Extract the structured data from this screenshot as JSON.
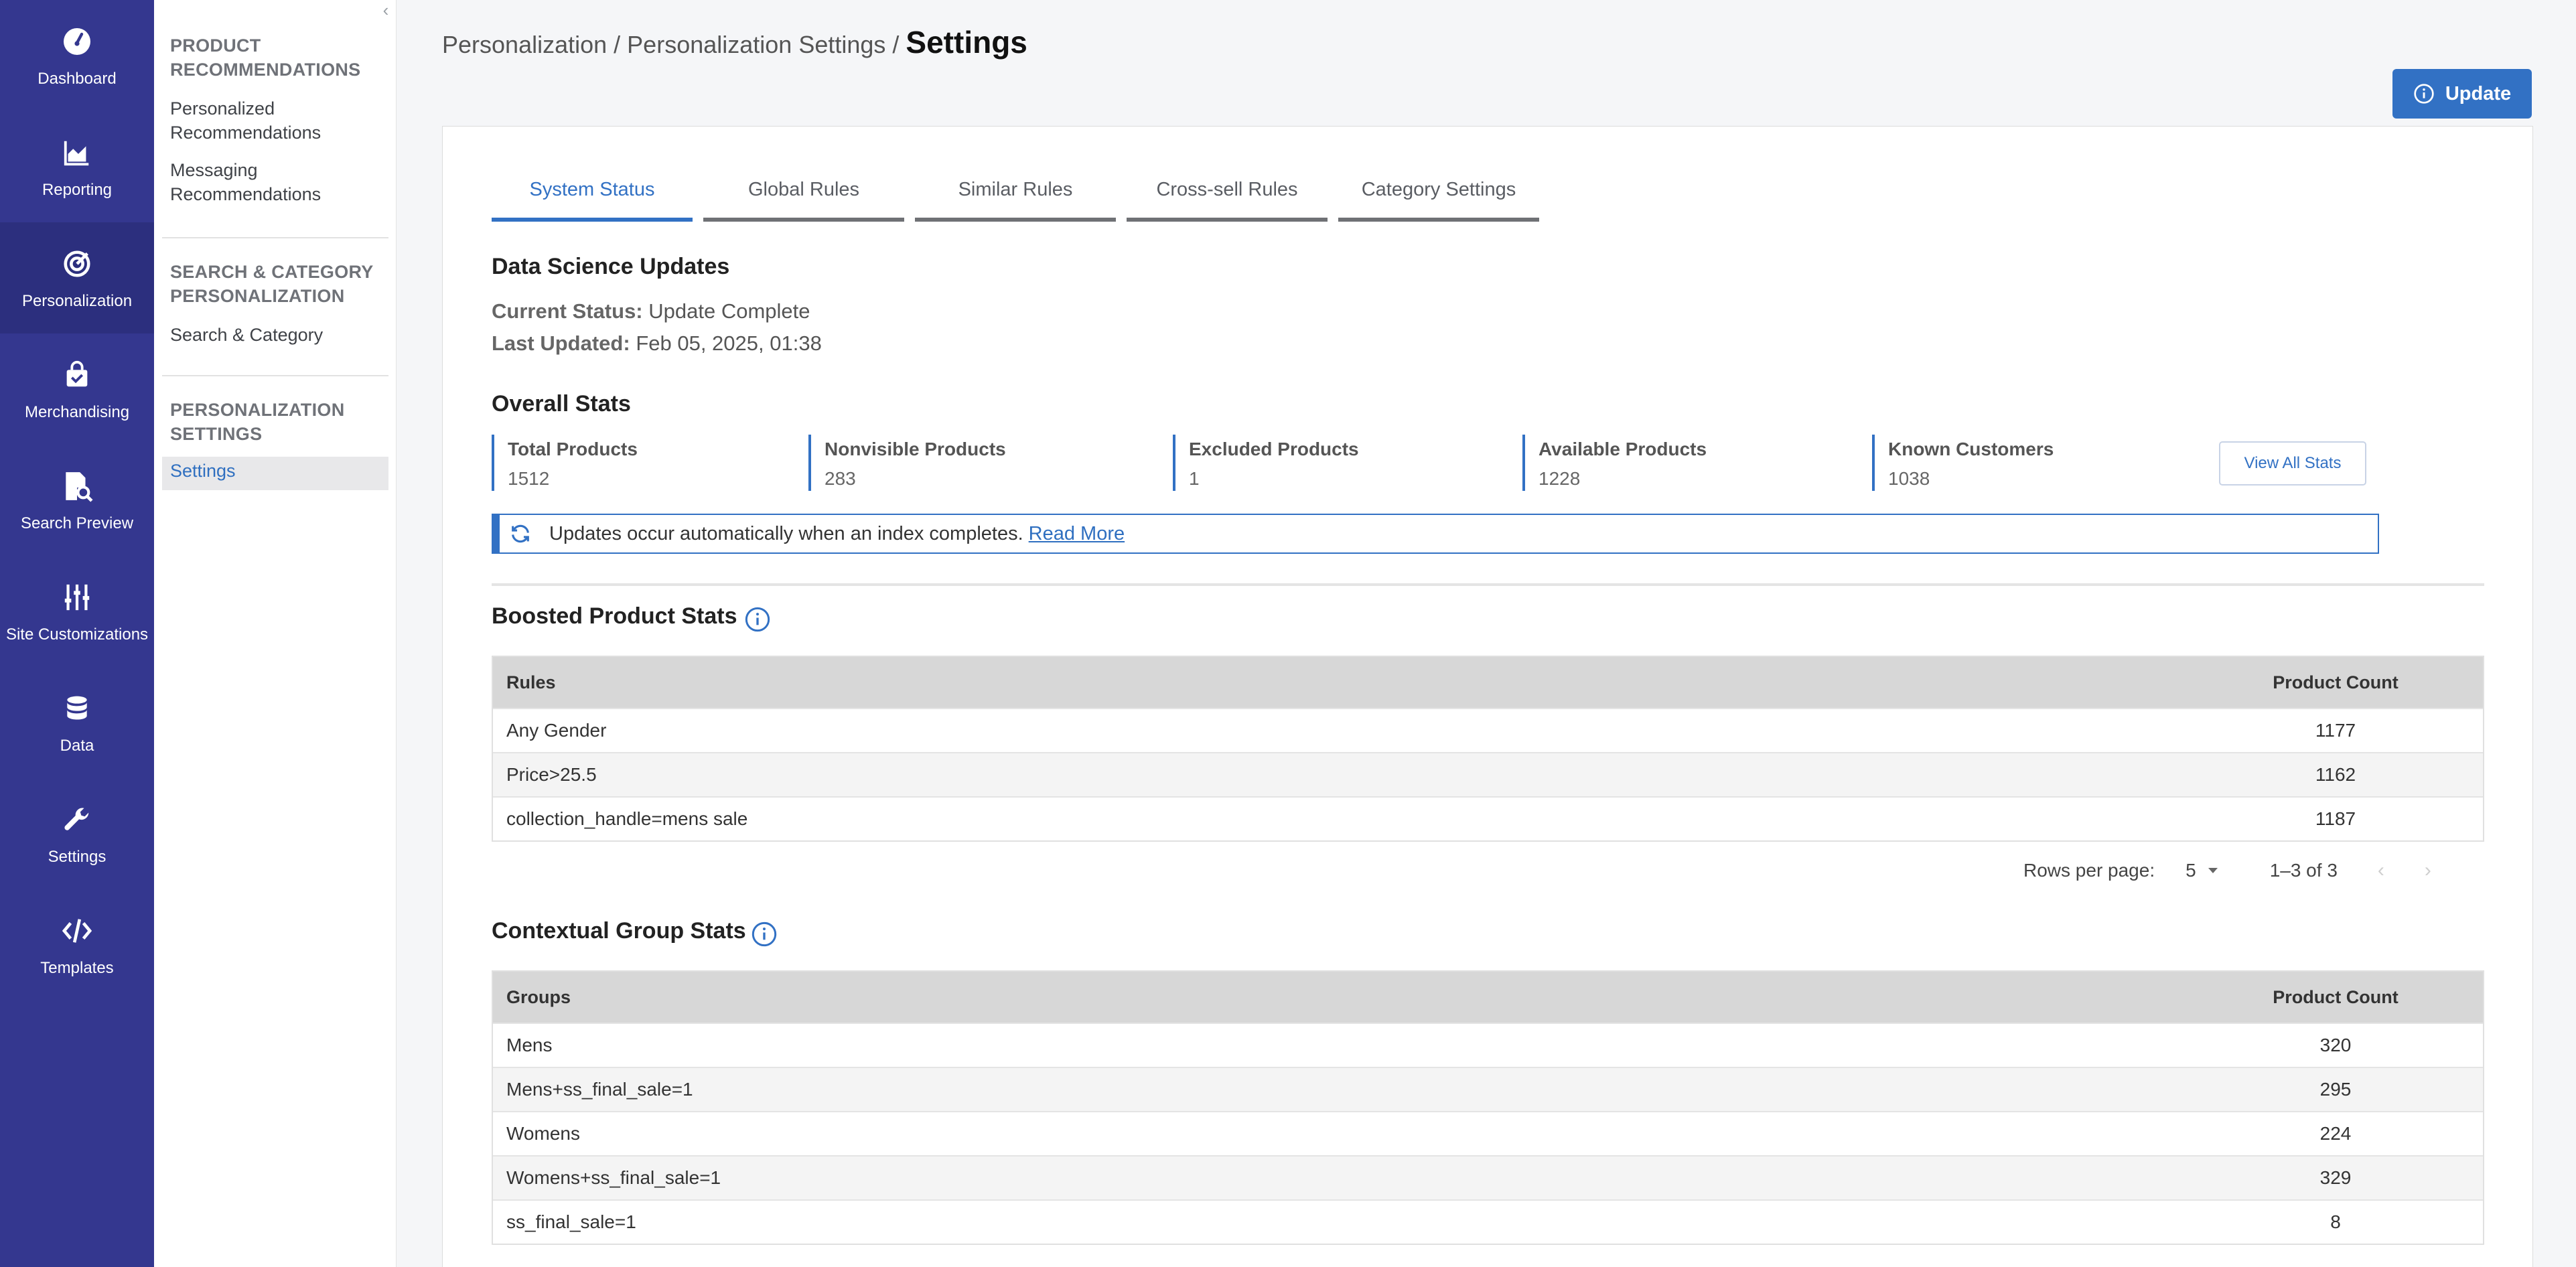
{
  "rail": {
    "items": [
      {
        "label": "Dashboard",
        "icon": "dashboard-gauge-icon"
      },
      {
        "label": "Reporting",
        "icon": "area-chart-icon"
      },
      {
        "label": "Personalization",
        "icon": "target-icon"
      },
      {
        "label": "Merchandising",
        "icon": "shopping-bag-icon"
      },
      {
        "label": "Search Preview",
        "icon": "search-document-icon"
      },
      {
        "label": "Site Customizations",
        "icon": "sliders-icon"
      },
      {
        "label": "Data",
        "icon": "database-icon"
      },
      {
        "label": "Settings",
        "icon": "wrench-icon"
      },
      {
        "label": "Templates",
        "icon": "code-icon"
      }
    ],
    "active": "Personalization"
  },
  "subnav": {
    "sections": [
      {
        "title_line1": "PRODUCT",
        "title_line2": "RECOMMENDATIONS",
        "links": [
          {
            "line1": "Personalized",
            "line2": "Recommendations"
          },
          {
            "line1": "Messaging",
            "line2": "Recommendations"
          }
        ]
      },
      {
        "title_line1": "SEARCH & CATEGORY",
        "title_line2": "PERSONALIZATION",
        "links": [
          {
            "line1": "Search & Category"
          }
        ]
      },
      {
        "title_line1": "PERSONALIZATION",
        "title_line2": "SETTINGS",
        "links": [
          {
            "line1": "Settings"
          }
        ]
      }
    ],
    "collapse_glyph": "‹"
  },
  "header": {
    "crumb1": "Personalization",
    "sep": " / ",
    "crumb2": "Personalization Settings",
    "current": "Settings",
    "update_label": "Update"
  },
  "tabs": [
    "System Status",
    "Global Rules",
    "Similar Rules",
    "Cross-sell Rules",
    "Category Settings"
  ],
  "active_tab": "System Status",
  "data_science": {
    "title": "Data Science Updates",
    "status_label": "Current Status:",
    "status_value": "Update Complete",
    "updated_label": "Last Updated:",
    "updated_value": "Feb 05, 2025, 01:38"
  },
  "overall": {
    "title": "Overall Stats",
    "stats": [
      {
        "label": "Total Products",
        "value": "1512"
      },
      {
        "label": "Nonvisible Products",
        "value": "283"
      },
      {
        "label": "Excluded Products",
        "value": "1"
      },
      {
        "label": "Available Products",
        "value": "1228"
      },
      {
        "label": "Known Customers",
        "value": "1038"
      }
    ],
    "view_all": "View All Stats",
    "banner_text": "Updates occur automatically when an index completes.",
    "banner_link": "Read More"
  },
  "boosted": {
    "title": "Boosted Product Stats",
    "col1": "Rules",
    "col2": "Product Count",
    "rows": [
      {
        "name": "Any Gender",
        "count": "1177"
      },
      {
        "name": "Price>25.5",
        "count": "1162"
      },
      {
        "name": "collection_handle=mens sale",
        "count": "1187"
      }
    ],
    "rows_per_page_label": "Rows per page:",
    "rows_per_page": "5",
    "range": "1–3 of 3"
  },
  "contextual": {
    "title": "Contextual Group Stats",
    "col1": "Groups",
    "col2": "Product Count",
    "rows": [
      {
        "name": "Mens",
        "count": "320"
      },
      {
        "name": "Mens+ss_final_sale=1",
        "count": "295"
      },
      {
        "name": "Womens",
        "count": "224"
      },
      {
        "name": "Womens+ss_final_sale=1",
        "count": "329"
      },
      {
        "name": "ss_final_sale=1",
        "count": "8"
      }
    ]
  },
  "colors": {
    "rail": "#34378f",
    "accent": "#3271c4"
  }
}
